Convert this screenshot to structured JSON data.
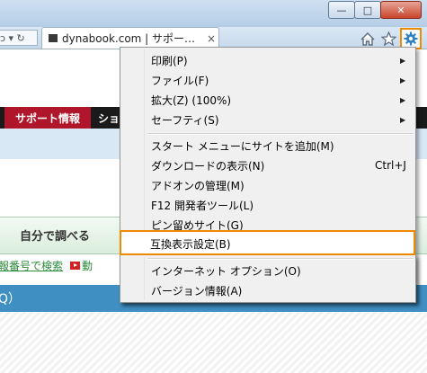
{
  "window": {
    "minimize_symbol": "—",
    "maximize_symbol": "□",
    "close_symbol": "✕"
  },
  "navbar": {
    "url_fragment": "ɔ ▾ ↻",
    "tab_title": "dynabook.com | サポー…",
    "tab_close": "×"
  },
  "toolbar": {
    "home_icon": "home-icon",
    "favorites_icon": "star-icon",
    "tools_icon": "gear-icon"
  },
  "page": {
    "support_tab": "サポート情報",
    "next_tab": "ショ",
    "self_button": "自分で調べる",
    "search_link": "報番号で検索",
    "video_link": "動",
    "faq_label": "Q）"
  },
  "menu": {
    "items": [
      {
        "label": "印刷(P)",
        "shortcut": "",
        "submenu": true
      },
      {
        "label": "ファイル(F)",
        "shortcut": "",
        "submenu": true
      },
      {
        "label": "拡大(Z) (100%)",
        "shortcut": "",
        "submenu": true
      },
      {
        "label": "セーフティ(S)",
        "shortcut": "",
        "submenu": true
      },
      {
        "label": "スタート メニューにサイトを追加(M)",
        "shortcut": "",
        "submenu": false
      },
      {
        "label": "ダウンロードの表示(N)",
        "shortcut": "Ctrl+J",
        "submenu": false
      },
      {
        "label": "アドオンの管理(M)",
        "shortcut": "",
        "submenu": false
      },
      {
        "label": "F12 開発者ツール(L)",
        "shortcut": "",
        "submenu": false
      },
      {
        "label": "ピン留めサイト(G)",
        "shortcut": "",
        "submenu": false
      },
      {
        "label": "互換表示設定(B)",
        "shortcut": "",
        "submenu": false
      },
      {
        "label": "インターネット オプション(O)",
        "shortcut": "",
        "submenu": false
      },
      {
        "label": "バージョン情報(A)",
        "shortcut": "",
        "submenu": false
      }
    ],
    "highlighted_item": "互換表示設定(B)",
    "highlight_color": "#f08a00"
  }
}
